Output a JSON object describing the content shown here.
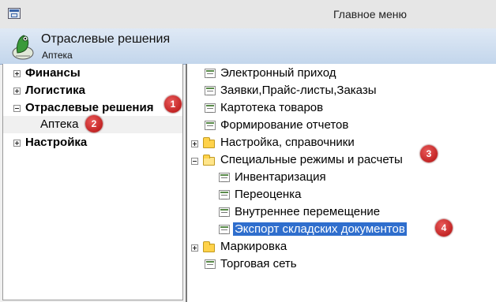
{
  "window": {
    "title": "Главное меню"
  },
  "header": {
    "title": "Отраслевые решения",
    "subtitle": "Аптека"
  },
  "left_tree": {
    "items": [
      {
        "label": "Финансы"
      },
      {
        "label": "Логистика"
      },
      {
        "label": "Отраслевые решения"
      },
      {
        "label": "Аптека"
      },
      {
        "label": "Настройка"
      }
    ]
  },
  "right_tree": {
    "items": [
      {
        "label": "Электронный приход"
      },
      {
        "label": "Заявки,Прайс-листы,Заказы"
      },
      {
        "label": "Картотека товаров"
      },
      {
        "label": "Формирование отчетов"
      },
      {
        "label": "Настройка, справочники"
      },
      {
        "label": "Специальные режимы и расчеты"
      },
      {
        "label": "Инвентаризация"
      },
      {
        "label": "Переоценка"
      },
      {
        "label": "Внутреннее перемещение"
      },
      {
        "label": "Экспорт складских документов"
      },
      {
        "label": "Маркировка"
      },
      {
        "label": "Торговая сеть"
      }
    ]
  },
  "badges": [
    "1",
    "2",
    "3",
    "4"
  ],
  "colors": {
    "selection": "#2f6ecd",
    "badge": "#c21818",
    "header": "#cfdff1"
  }
}
